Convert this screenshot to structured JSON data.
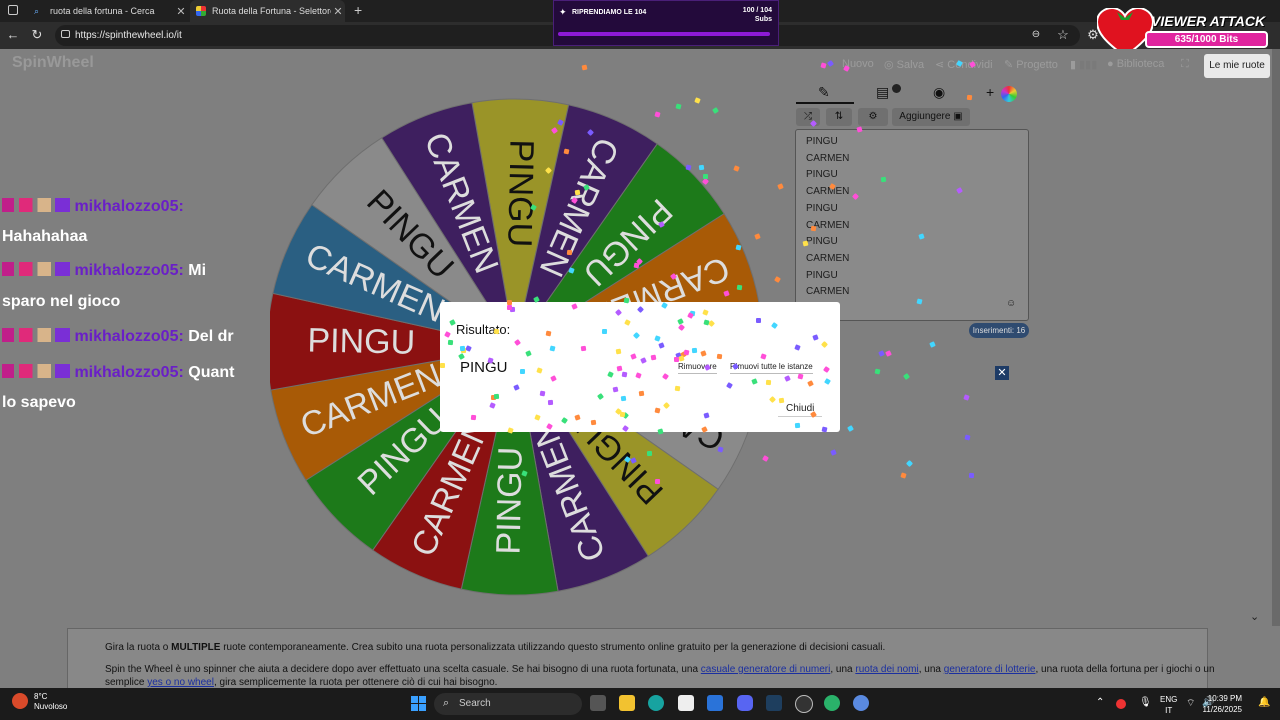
{
  "browser": {
    "tabs": [
      {
        "label": "ruota della fortuna - Cerca",
        "close": "✕"
      },
      {
        "label": "Ruota della Fortuna - Selettore P",
        "close": "✕"
      }
    ],
    "new_tab": "+",
    "url": "https://spinthewheel.io/it"
  },
  "overlay": {
    "subgoal_title": "RIPRENDIAMO LE 104",
    "subgoal_count": "100 / 104",
    "subgoal_unit": "Subs",
    "viewer_attack_title": "VIEWER ATTACK",
    "viewer_attack_bits": "635/1000 Bits"
  },
  "site": {
    "logo": "SpinWheel",
    "menu": {
      "nuovo": "Nuovo",
      "salva": "Salva",
      "condividi": "Condividi",
      "progetto": "Progetto",
      "biblioteca": "Biblioteca"
    },
    "le_mie_ruote": "Le mie ruote",
    "aggiungere": "Aggiungere",
    "entries": [
      "PINGU",
      "CARMEN",
      "PINGU",
      "CARMEN",
      "PINGU",
      "CARMEN",
      "PINGU",
      "CARMEN",
      "PINGU",
      "CARMEN"
    ],
    "inserimenti": "Inserimenti: 16"
  },
  "wheel": {
    "segments": [
      {
        "label": "PINGU",
        "color": "#9a9428"
      },
      {
        "label": "CARMEN",
        "color": "#3e1f5f"
      },
      {
        "label": "PINGU",
        "color": "#1d7a1a"
      },
      {
        "label": "CARMEN",
        "color": "#a85a06"
      },
      {
        "label": "PINGU",
        "color": "#2a5f82"
      },
      {
        "label": "CARMEN",
        "color": "#8a8a8a"
      },
      {
        "label": "PINGU",
        "color": "#9a9428"
      },
      {
        "label": "CARMEN",
        "color": "#3e1f5f"
      },
      {
        "label": "PINGU",
        "color": "#1d7a1a"
      },
      {
        "label": "CARMEN",
        "color": "#8b1111"
      },
      {
        "label": "PINGU",
        "color": "#1d7a1a"
      },
      {
        "label": "CARMEN",
        "color": "#a85a06"
      },
      {
        "label": "PINGU",
        "color": "#8b1111"
      },
      {
        "label": "CARMEN",
        "color": "#2a5f82"
      },
      {
        "label": "PINGU",
        "color": "#8a8a8a"
      },
      {
        "label": "CARMEN",
        "color": "#3e1f5f"
      }
    ]
  },
  "chat": [
    {
      "user": "mikhalozzo05:",
      "text": "",
      "cont": "Hahahahaa"
    },
    {
      "user": "mikhalozzo05:",
      "text": "Mi",
      "cont": "sparo nel gioco"
    },
    {
      "user": "mikhalozzo05:",
      "text": "Del dr",
      "cont": ""
    },
    {
      "user": "mikhalozzo05:",
      "text": "Quant",
      "cont": "lo sapevo"
    }
  ],
  "modal": {
    "label": "Risultato:",
    "result": "PINGU",
    "remove": "Rimuovere",
    "remove_all": "Rimuovi tutte le istanze",
    "close": "Chiudi"
  },
  "body_text": {
    "p1_a": "Gira la ruota o ",
    "p1_b": "MULTIPLE",
    "p1_c": " ruote contemporaneamente. Crea subito una ruota personalizzata utilizzando questo strumento online gratuito per la generazione di decisioni casuali.",
    "p2_a": "Spin the Wheel è uno spinner che aiuta a decidere dopo aver effettuato una scelta casuale. Se hai bisogno di una ruota fortunata, una ",
    "p2_l1": "casuale generatore di numeri",
    "p2_b": ", una ",
    "p2_l2": "ruota dei nomi",
    "p2_c": ", una ",
    "p2_l3": "generatore di lotterie",
    "p2_d": ", una ruota della fortuna per i giochi o un",
    "p3_a": "semplice ",
    "p3_l": "yes o no wheel",
    "p3_b": ", gira semplicemente la ruota per ottenere ciò di cui hai bisogno."
  },
  "taskbar": {
    "temp": "8°C",
    "weather": "Nuvoloso",
    "search": "Search",
    "lang1": "ENG",
    "lang2": "IT",
    "time": "10:39 PM",
    "date": "11/26/2025"
  }
}
